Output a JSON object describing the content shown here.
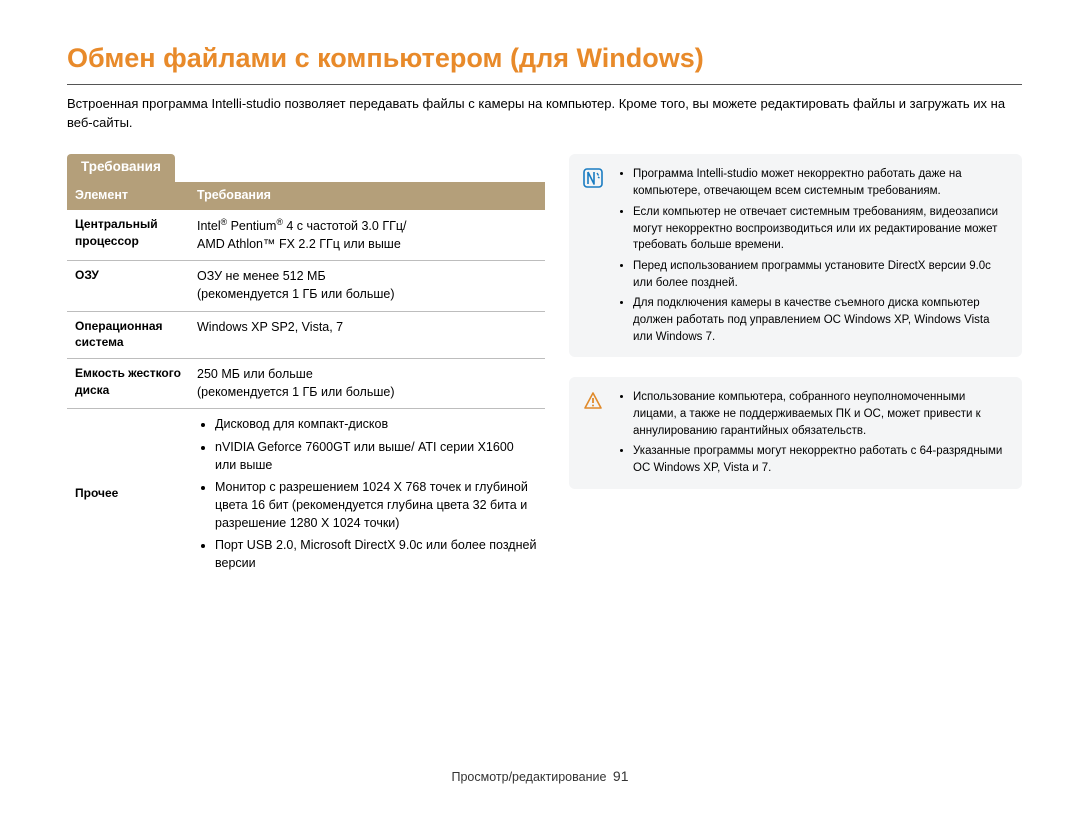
{
  "title": "Обмен файлами с компьютером (для Windows)",
  "intro": "Встроенная программа Intelli-studio позволяет передавать файлы с камеры на компьютер. Кроме того, вы можете редактировать файлы и загружать их на веб-сайты.",
  "section_heading": "Требования",
  "table": {
    "head_item": "Элемент",
    "head_req": "Требования",
    "rows": {
      "cpu": {
        "label": "Центральный процессор",
        "value_line1_pre": "Intel",
        "value_line1_mid": " Pentium",
        "value_line1_post": " 4 с частотой 3.0 ГГц/",
        "value_line2": "AMD Athlon™ FX 2.2 ГГц или выше"
      },
      "ram": {
        "label": "ОЗУ",
        "value_line1": "ОЗУ не менее 512 МБ",
        "value_line2": "(рекомендуется 1 ГБ или больше)"
      },
      "os": {
        "label": "Операционная система",
        "value": "Windows XP SP2, Vista, 7"
      },
      "hdd": {
        "label": "Емкость жесткого диска",
        "value_line1": "250 МБ или больше",
        "value_line2": "(рекомендуется 1 ГБ или больше)"
      },
      "other": {
        "label": "Прочее",
        "items": {
          "i1": "Дисковод для компакт-дисков",
          "i2": "nVIDIA Geforce 7600GT или выше/ ATI серии X1600 или выше",
          "i3": "Монитор с разрешением 1024 X 768 точек и глубиной цвета 16 бит (рекомендуется глубина цвета 32 бита и разрешение 1280 X 1024 точки)",
          "i4": "Порт USB 2.0, Microsoft DirectX 9.0c или более поздней версии"
        }
      }
    }
  },
  "info_notes": {
    "n1": "Программа Intelli-studio может некорректно работать даже на компьютере, отвечающем всем системным требованиям.",
    "n2": "Если компьютер не отвечает системным требованиям, видеозаписи могут некорректно воспроизводиться или их редактирование может требовать больше времени.",
    "n3": "Перед использованием программы установите DirectX версии 9.0c или более поздней.",
    "n4": "Для подключения камеры в качестве съемного диска компьютер должен работать под управлением ОС Windows XP, Windows Vista или Windows 7."
  },
  "warn_notes": {
    "w1": "Использование компьютера, собранного неуполномоченными лицами, а также не поддерживаемых ПК и ОС, может привести к аннулированию гарантийных обязательств.",
    "w2": "Указанные программы могут некорректно работать с 64-разрядными ОС Windows XP, Vista и 7."
  },
  "footer": {
    "section": "Просмотр/редактирование",
    "page": "91"
  }
}
